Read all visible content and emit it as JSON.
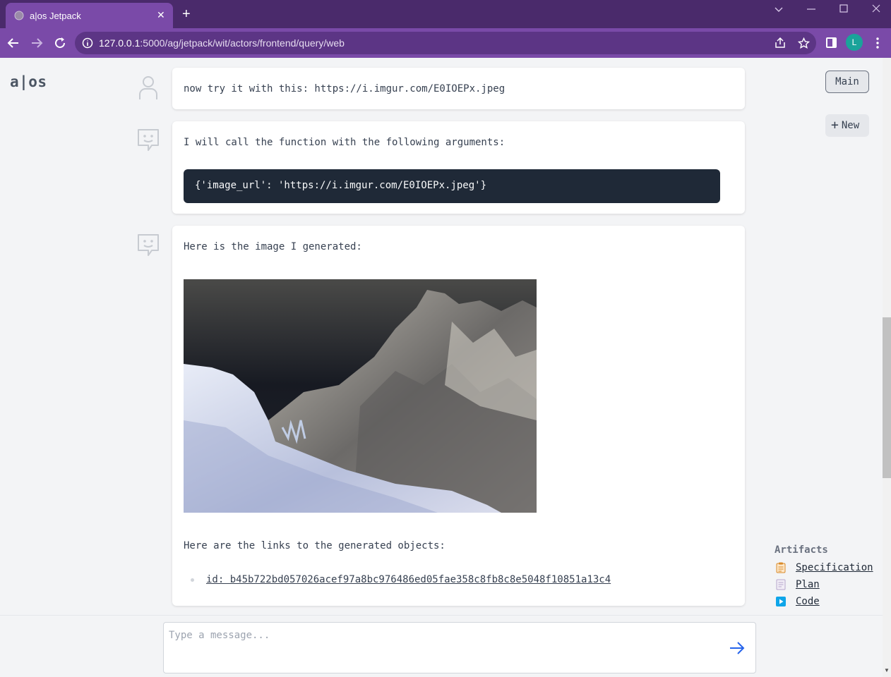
{
  "browser": {
    "tab_title": "a|os Jetpack",
    "tab_close": "✕",
    "new_tab": "+",
    "url_host": "127.0.0.1",
    "url_rest": ":5000/ag/jetpack/wit/actors/frontend/query/web",
    "profile_initial": "L"
  },
  "app": {
    "logo": "a|os",
    "main_button": "Main",
    "new_button": "New"
  },
  "messages": [
    {
      "role": "user",
      "text": "now try it with this: https://i.imgur.com/E0IOEPx.jpeg"
    },
    {
      "role": "assistant",
      "text": "I will call the function with the following arguments:",
      "code": "{'image_url': 'https://i.imgur.com/E0IOEPx.jpeg'}"
    },
    {
      "role": "assistant",
      "intro": "Here is the image I generated:",
      "links_intro": "Here are the links to the generated objects:",
      "link": "id: b45b722bd057026acef97a8bc976486ed05fae358c8fb8c8e5048f10851a13c4"
    }
  ],
  "artifacts": {
    "header": "Artifacts",
    "items": [
      {
        "label": "Specification",
        "icon": "clipboard-icon"
      },
      {
        "label": "Plan",
        "icon": "document-icon"
      },
      {
        "label": "Code",
        "icon": "play-icon"
      }
    ]
  },
  "composer": {
    "placeholder": "Type a message..."
  },
  "colors": {
    "tabbar": "#4a2a6b",
    "toolbar": "#7a4aa8",
    "code_bg": "#1f2937",
    "send_arrow": "#2563eb"
  }
}
